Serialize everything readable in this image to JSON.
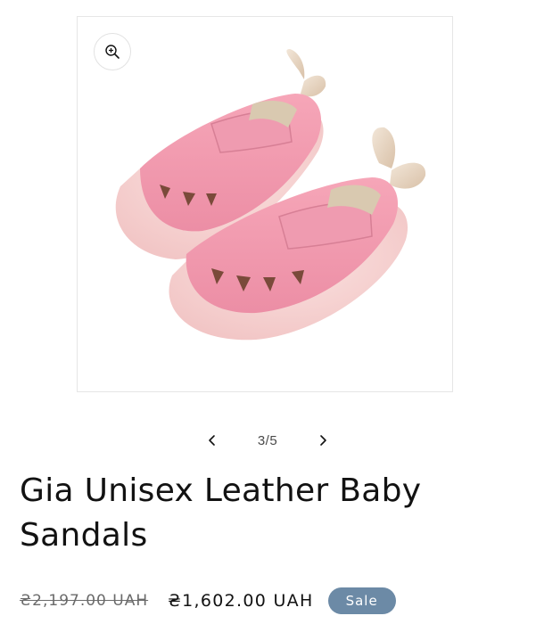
{
  "product": {
    "image_alt": "Pink leather baby sandals with bunny ears",
    "title": "Gia Unisex Leather Baby Sandals"
  },
  "gallery": {
    "counter_current": "3",
    "counter_separator": "/",
    "counter_total": "5",
    "prev_icon": "chevron-left-icon",
    "next_icon": "chevron-right-icon",
    "zoom_icon": "zoom-in-icon"
  },
  "pricing": {
    "regular_price": "₴2,197.00 UAH",
    "sale_price": "₴1,602.00 UAH",
    "badge": "Sale",
    "badge_color": "#6c8aa6"
  }
}
